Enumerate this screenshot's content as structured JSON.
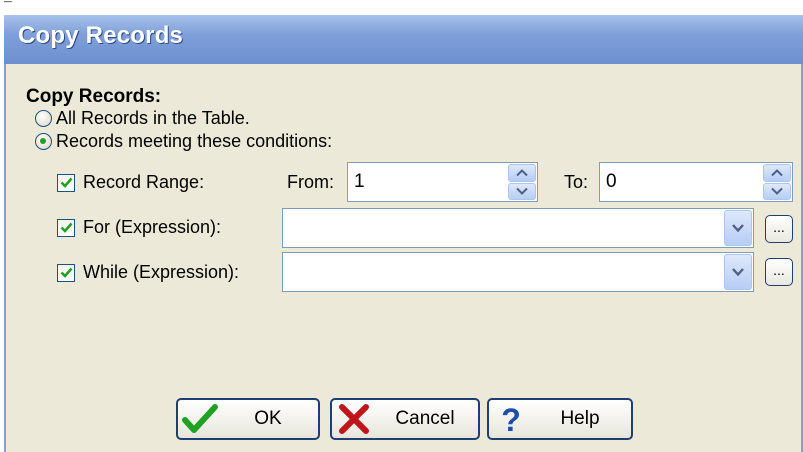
{
  "window": {
    "title": "Copy Records"
  },
  "copy_records": {
    "section_label": "Copy Records:",
    "options": [
      {
        "label": "All Records in the Table.",
        "selected": false
      },
      {
        "label": "Records meeting these conditions:",
        "selected": true
      }
    ]
  },
  "conditions": {
    "record_range": {
      "label": "Record Range:",
      "checked": true,
      "from_label": "From:",
      "from_value": "1",
      "to_label": "To:",
      "to_value": "0"
    },
    "for_expression": {
      "label": "For (Expression):",
      "checked": true,
      "value": "",
      "ellipsis_label": "..."
    },
    "while_expression": {
      "label": "While (Expression):",
      "checked": true,
      "value": "",
      "ellipsis_label": "..."
    }
  },
  "buttons": {
    "ok": "OK",
    "cancel": "Cancel",
    "help": "Help"
  },
  "colors": {
    "title_bar": "#7e9fd8",
    "dialog_bg": "#ece9d8",
    "check_green": "#21a121",
    "cancel_red": "#c0141b",
    "help_blue": "#1b4fa8"
  }
}
